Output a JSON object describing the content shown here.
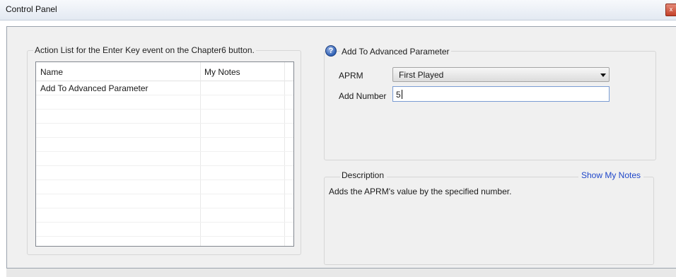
{
  "window": {
    "title": "Control Panel",
    "close_glyph": "x"
  },
  "action_list": {
    "caption": "Action List for the Enter Key event on the Chapter6 button.",
    "columns": [
      "Name",
      "My Notes"
    ],
    "rows": [
      {
        "name": "Add To Advanced Parameter",
        "notes": ""
      }
    ]
  },
  "parameter_panel": {
    "help_icon": "question-mark-icon",
    "help_glyph": "?",
    "caption": "Add To Advanced Parameter",
    "aprm_label": "APRM",
    "aprm_selected": "First Played",
    "add_number_label": "Add Number",
    "add_number_value": "5"
  },
  "description": {
    "caption": "Description",
    "show_notes_link": "Show My Notes",
    "text": "Adds the APRM's value by the specified number."
  },
  "colors": {
    "link": "#1f47c9",
    "close_button": "#c4412a"
  }
}
